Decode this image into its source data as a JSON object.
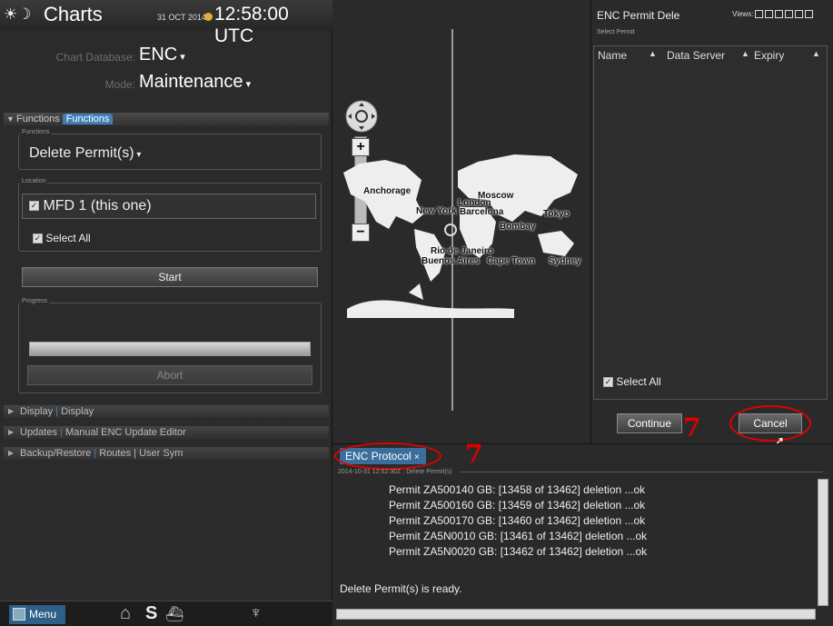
{
  "header": {
    "app_title": "Charts",
    "date": "31 OCT 2014",
    "time": "12:58:00 UTC",
    "chart_db_label": "Chart Database:",
    "chart_db_value": "ENC",
    "mode_label": "Mode:",
    "mode_value": "Maintenance"
  },
  "functions": {
    "header_label": "Functions",
    "header_tag": "Functions",
    "group_label": "Functions",
    "selected": "Delete Permit(s)",
    "location_label": "Location",
    "location_value": "MFD 1 (this one)",
    "select_all": "Select All",
    "start_label": "Start",
    "progress_label": "Progress",
    "progress_fraction": 1.0,
    "abort_label": "Abort"
  },
  "collapsed_sections": [
    {
      "label": "Display",
      "tag": "Display"
    },
    {
      "label": "Updates",
      "tag": "Manual ENC Update Editor"
    },
    {
      "label": "Backup/Restore",
      "tag": "Routes | User Sym"
    }
  ],
  "footer": {
    "menu_label": "Menu"
  },
  "map": {
    "labels": [
      "Anchorage",
      "New York",
      "London",
      "Moscow",
      "Barcelona",
      "Tokyo",
      "Bombay",
      "Rio de Janeiro",
      "Buenos Aires",
      "Cape Town",
      "Sydney"
    ]
  },
  "permit_panel": {
    "title": "ENC Permit Dele",
    "views_label": "Views:",
    "select_permit_label": "Select Permit",
    "columns": [
      "Name",
      "Data Server",
      "Expiry"
    ],
    "select_all": "Select All",
    "continue_label": "Continue",
    "cancel_label": "Cancel"
  },
  "annotations": {
    "step_number": "7"
  },
  "protocol": {
    "tab_label": "ENC Protocol",
    "timestamp": "2014-10-31 12:52:30Z : Delete Permit(s)",
    "lines": [
      "Permit ZA500140 GB: [13458 of 13462] deletion ...ok",
      "Permit ZA500160 GB: [13459 of 13462] deletion ...ok",
      "Permit ZA500170 GB: [13460 of 13462] deletion ...ok",
      "Permit ZA5N0010 GB: [13461 of 13462] deletion ...ok",
      "Permit ZA5N0020 GB: [13462 of 13462] deletion ...ok"
    ],
    "ready_text": "Delete Permit(s) is ready."
  }
}
